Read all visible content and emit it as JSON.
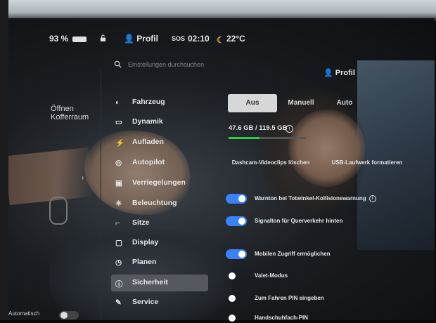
{
  "status": {
    "battery": "93 %",
    "profile": "Profil",
    "sos": "SOS",
    "time": "02:10",
    "temperature": "22°C"
  },
  "search": {
    "placeholder": "Einstellungen durchsuchen"
  },
  "header": {
    "profile": "Profil"
  },
  "trunk": {
    "line1": "Öffnen",
    "line2": "Kofferraum"
  },
  "menu": [
    {
      "label": "Fahrzeug",
      "icon": "toggle-icon"
    },
    {
      "label": "Dynamik",
      "icon": "car-icon"
    },
    {
      "label": "Aufladen",
      "icon": "bolt-icon"
    },
    {
      "label": "Autopilot",
      "icon": "steering-wheel-icon"
    },
    {
      "label": "Verriegelungen",
      "icon": "lock-icon"
    },
    {
      "label": "Beleuchtung",
      "icon": "sun-icon"
    },
    {
      "label": "Sitze",
      "icon": "seat-icon"
    },
    {
      "label": "Display",
      "icon": "display-icon"
    },
    {
      "label": "Planen",
      "icon": "clock-icon"
    },
    {
      "label": "Sicherheit",
      "icon": "info-icon",
      "active": true
    },
    {
      "label": "Service",
      "icon": "wrench-icon"
    }
  ],
  "tabs": {
    "aus": "Aus",
    "manuell": "Manuell",
    "auto": "Auto"
  },
  "storage": {
    "text": "47.6 GB / 119.5 GB",
    "used_fraction": 0.4
  },
  "buttons": {
    "dashcam": "Dashcam-Videoclips löschen",
    "usb": "USB-Laufwerk formatieren"
  },
  "settings": [
    {
      "label": "Warnton bei Totwinkel-Kollisionswarnung",
      "on": true,
      "info": true
    },
    {
      "label": "Signalton für Querverkehr hinten",
      "on": true
    },
    {
      "label": "Mobilen Zugriff ermöglichen",
      "on": true
    },
    {
      "label": "Valet-Modus",
      "on": false
    },
    {
      "label": "Zum Fahren PIN eingeben",
      "on": false
    },
    {
      "label": "Handschuhfach-PIN",
      "on": false
    }
  ],
  "bottom": {
    "label": "Automatisch"
  },
  "colors": {
    "accent": "#3b82f6",
    "storage": "#2ecc40",
    "active_bg": "#55595f"
  }
}
